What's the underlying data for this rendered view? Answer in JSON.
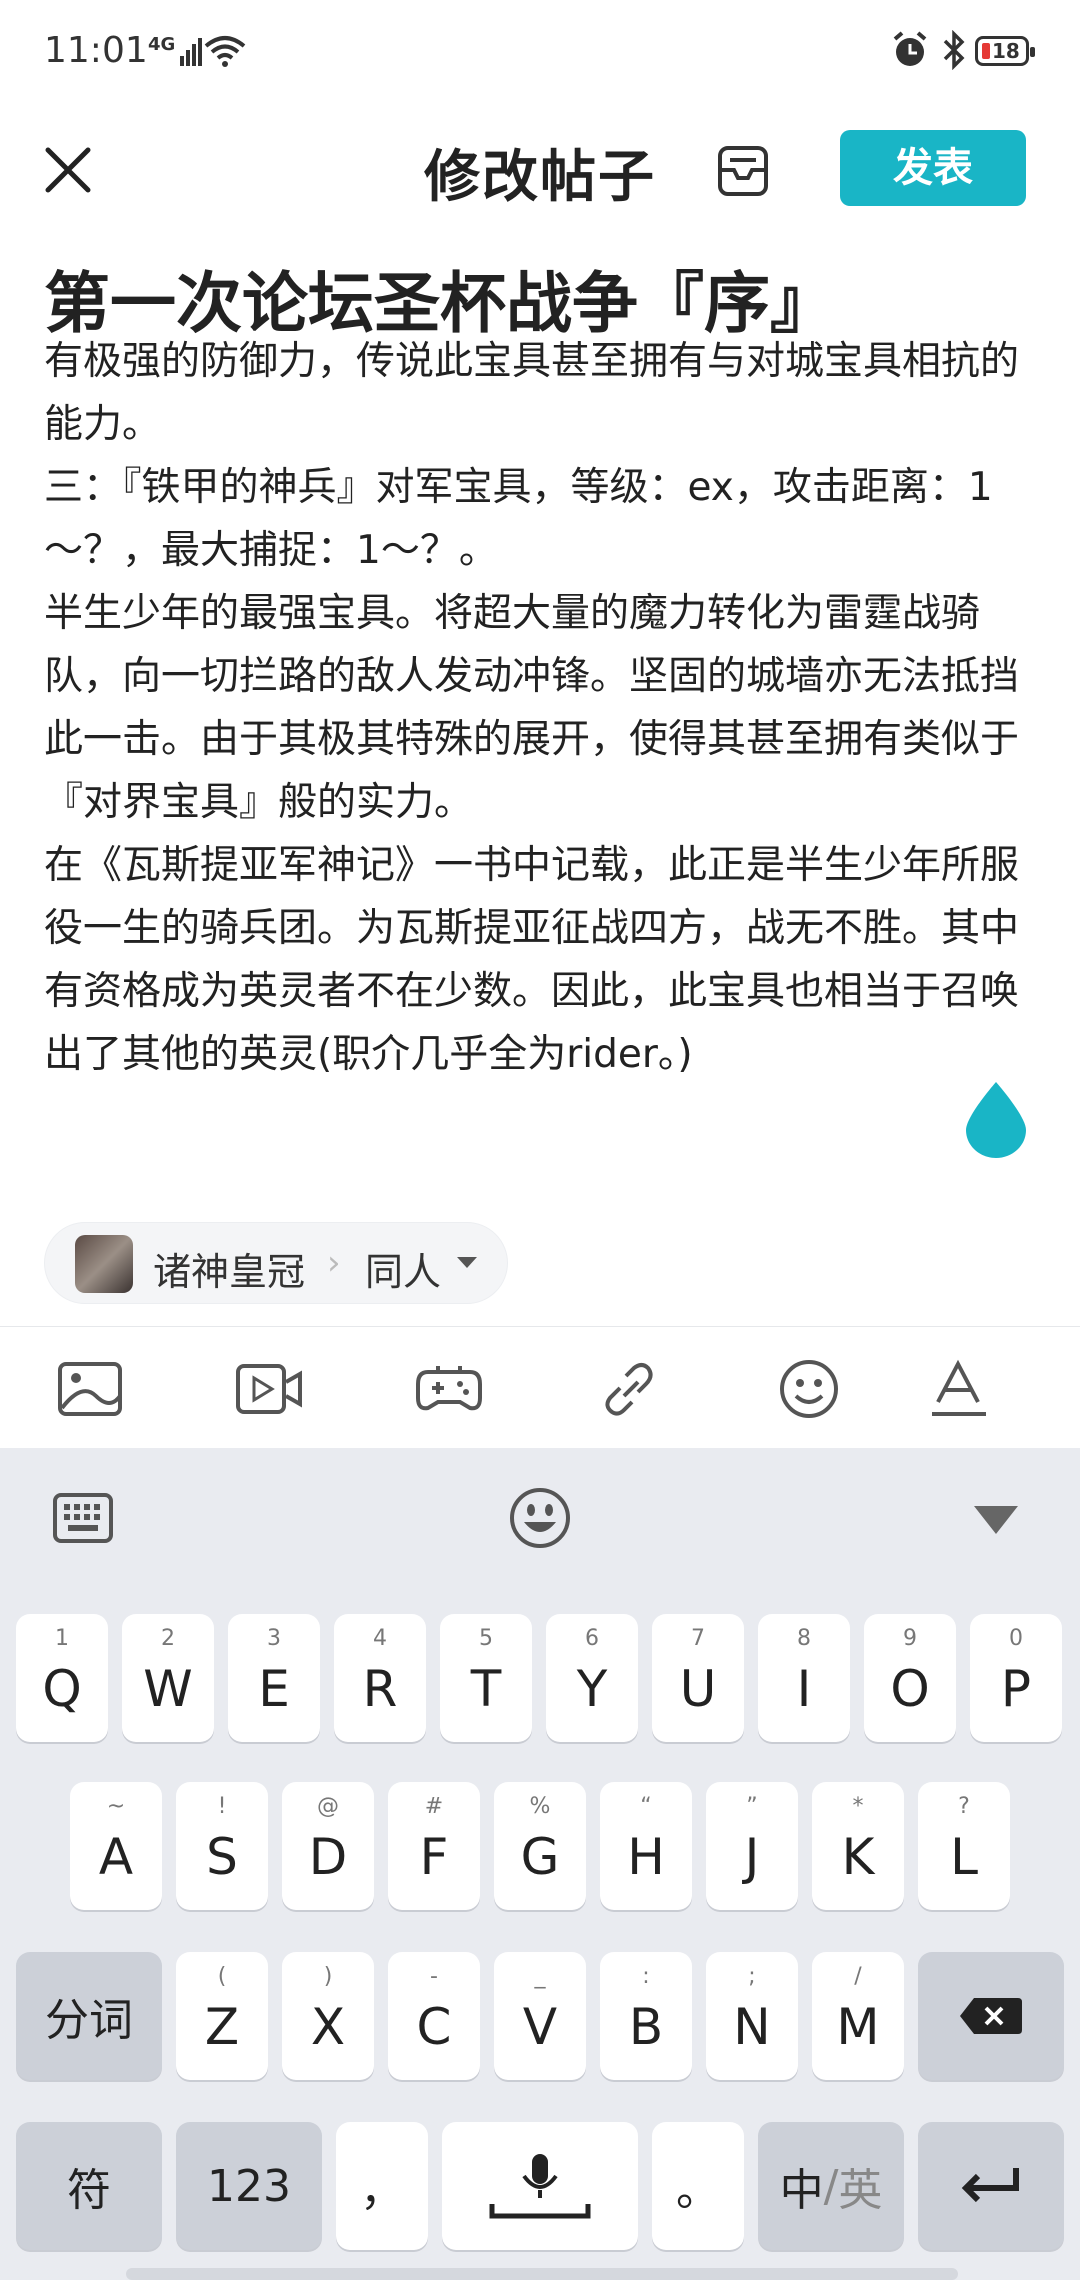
{
  "status_bar": {
    "time": "11:01",
    "network": "4G",
    "battery": "18"
  },
  "header": {
    "title": "修改帖子",
    "publish_label": "发表"
  },
  "post": {
    "title": "第一次论坛圣杯战争『序』",
    "paragraphs": [
      "有极强的防御力，传说此宝具甚至拥有与对城宝具相抗的能力。",
      "三：『铁甲的神兵』对军宝具，等级：ex，攻击距离：1～？，最大捕捉：1～？。",
      "半生少年的最强宝具。将超大量的魔力转化为雷霆战骑队，向一切拦路的敌人发动冲锋。坚固的城墙亦无法抵挡此一击。由于其极其特殊的展开，使得其甚至拥有类似于『对界宝具』般的实力。",
      "在《瓦斯提亚军神记》一书中记载，此正是半生少年所服役一生的骑兵团。为瓦斯提亚征战四方，战无不胜。其中有资格成为英灵者不在少数。因此，此宝具也相当于召唤出了其他的英灵(职介几乎全为rider。)"
    ]
  },
  "forum_tag": {
    "name": "诸神皇冠",
    "category": "同人"
  },
  "toolbar": {
    "icons": [
      "image-icon",
      "video-icon",
      "game-icon",
      "link-icon",
      "emoji-icon",
      "text-format-icon"
    ]
  },
  "keyboard": {
    "row1": [
      {
        "hint": "1",
        "key": "Q"
      },
      {
        "hint": "2",
        "key": "W"
      },
      {
        "hint": "3",
        "key": "E"
      },
      {
        "hint": "4",
        "key": "R"
      },
      {
        "hint": "5",
        "key": "T"
      },
      {
        "hint": "6",
        "key": "Y"
      },
      {
        "hint": "7",
        "key": "U"
      },
      {
        "hint": "8",
        "key": "I"
      },
      {
        "hint": "9",
        "key": "O"
      },
      {
        "hint": "0",
        "key": "P"
      }
    ],
    "row2": [
      {
        "hint": "~",
        "key": "A"
      },
      {
        "hint": "!",
        "key": "S"
      },
      {
        "hint": "@",
        "key": "D"
      },
      {
        "hint": "#",
        "key": "F"
      },
      {
        "hint": "%",
        "key": "G"
      },
      {
        "hint": "“",
        "key": "H"
      },
      {
        "hint": "”",
        "key": "J"
      },
      {
        "hint": "*",
        "key": "K"
      },
      {
        "hint": "?",
        "key": "L"
      }
    ],
    "row3": [
      {
        "hint": "(",
        "key": "Z"
      },
      {
        "hint": ")",
        "key": "X"
      },
      {
        "hint": "-",
        "key": "C"
      },
      {
        "hint": "_",
        "key": "V"
      },
      {
        "hint": ":",
        "key": "B"
      },
      {
        "hint": ";",
        "key": "N"
      },
      {
        "hint": "/",
        "key": "M"
      }
    ],
    "segment_label": "分词",
    "symbol_label": "符",
    "numbers_label": "123",
    "comma_label": "，",
    "period_label": "。",
    "lang_cn": "中",
    "lang_sep": "/",
    "lang_en": "英"
  }
}
